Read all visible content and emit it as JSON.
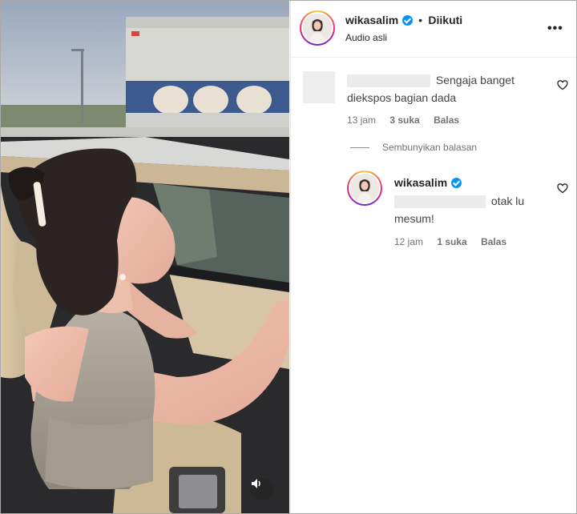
{
  "post": {
    "username": "wikasalim",
    "separator": "•",
    "follow_status": "Diikuti",
    "audio": "Audio asli",
    "more_icon": "more-horizontal-icon"
  },
  "comments": [
    {
      "text": "Sengaja banget diekspos bagian dada",
      "time": "13 jam",
      "likes": "3 suka",
      "reply": "Balas"
    }
  ],
  "replies_toggle": "Sembunyikan balasan",
  "replies": [
    {
      "username": "wikasalim",
      "text": "otak lu mesum!",
      "time": "12 jam",
      "likes": "1 suka",
      "reply": "Balas"
    }
  ],
  "colors": {
    "verified": "#0095f6",
    "text": "#262626",
    "secondary": "#737373"
  }
}
